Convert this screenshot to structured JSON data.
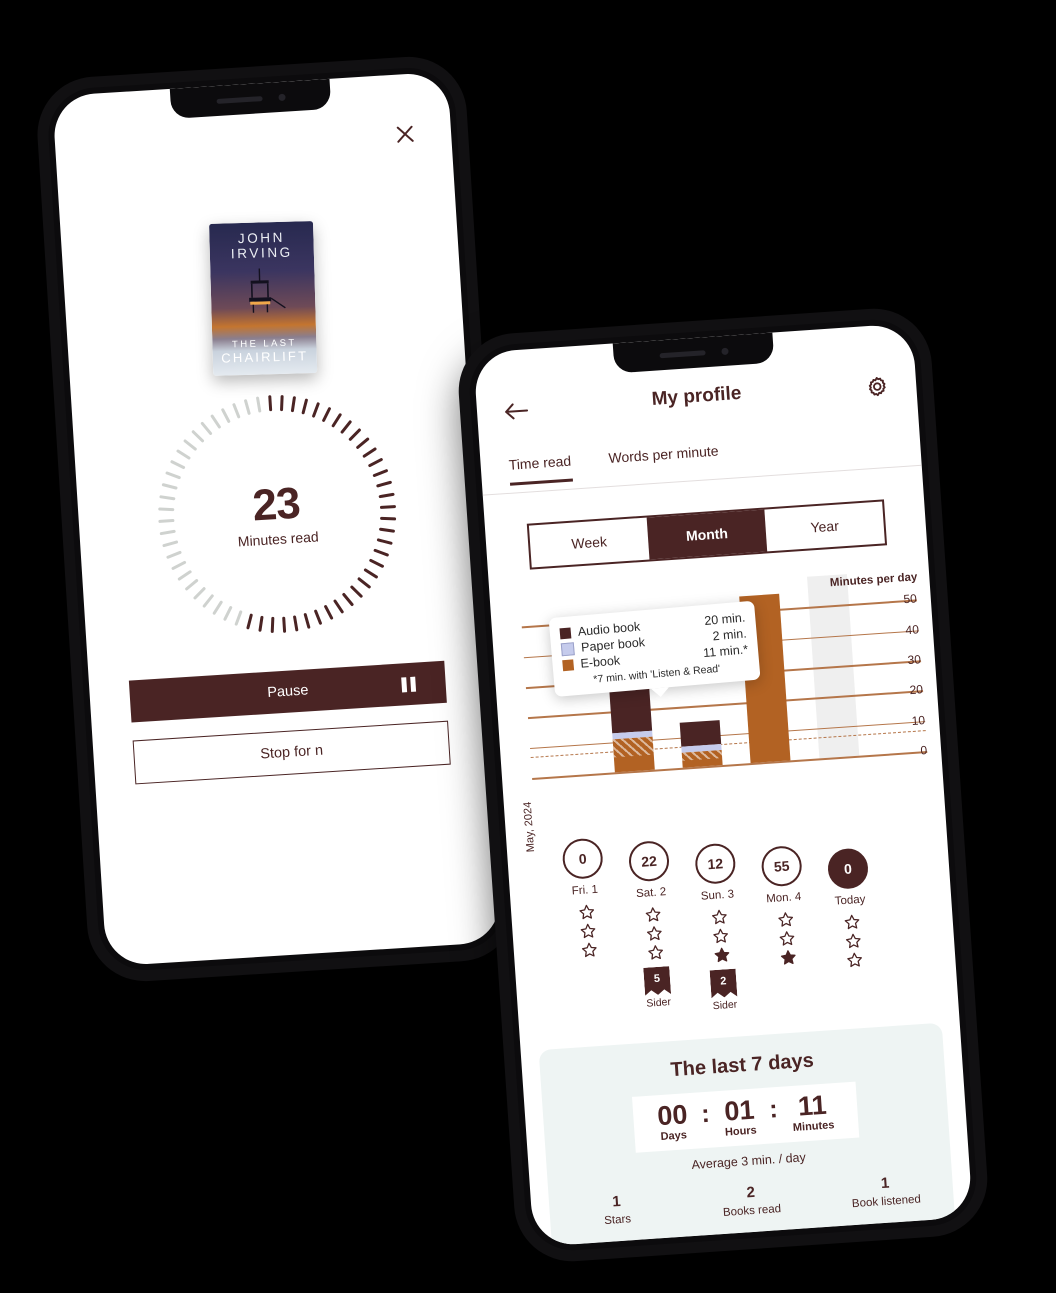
{
  "colors": {
    "brand": "#4A2424",
    "audio": "#4A2424",
    "paper": "#C5CBEC",
    "ebook": "#B26223",
    "grid": "#B5764A",
    "panel_bg": "#EEF4F3",
    "today_col": "#EFEFEF"
  },
  "reader": {
    "close_icon": "close-icon",
    "book": {
      "author": "JOHN IRVING",
      "author_line1": "JOHN",
      "author_line2": "IRVING",
      "title_line1": "THE LAST",
      "title_line2": "CHAIRLIFT"
    },
    "timer": {
      "value": "23",
      "label": "Minutes read",
      "ticks_total": 60,
      "ticks_active": 34
    },
    "pause_button": "Pause",
    "pause_icon": "pause-icon",
    "stop_button": "Stop for n"
  },
  "profile": {
    "back_icon": "back-arrow-icon",
    "title": "My profile",
    "settings_icon": "gear-icon",
    "tabs": [
      {
        "label": "Time read",
        "active": true
      },
      {
        "label": "Words per minute",
        "active": false
      }
    ],
    "range": [
      {
        "label": "Week",
        "active": false
      },
      {
        "label": "Month",
        "active": true
      },
      {
        "label": "Year",
        "active": false
      }
    ],
    "tooltip": {
      "rows": [
        {
          "name": "Audio book",
          "value": "20 min.",
          "color": "#4A2424"
        },
        {
          "name": "Paper book",
          "value": "2 min.",
          "color": "#C5CBEC"
        },
        {
          "name": "E-book",
          "value": "11 min.*",
          "color": "#B26223"
        }
      ],
      "note": "*7 min. with 'Listen & Read'"
    },
    "month_label": "May, 2024",
    "days": [
      {
        "value": "0",
        "label": "Fri. 1",
        "today": false,
        "stars_outline": 3,
        "stars_filled": 0,
        "badge": null
      },
      {
        "value": "22",
        "label": "Sat. 2",
        "today": false,
        "stars_outline": 3,
        "stars_filled": 0,
        "badge": {
          "num": "5",
          "label": "Sider"
        }
      },
      {
        "value": "12",
        "label": "Sun. 3",
        "today": false,
        "stars_outline": 2,
        "stars_filled": 1,
        "badge": {
          "num": "2",
          "label": "Sider"
        }
      },
      {
        "value": "55",
        "label": "Mon. 4",
        "today": false,
        "stars_outline": 2,
        "stars_filled": 1,
        "badge": null
      },
      {
        "value": "0",
        "label": "Today",
        "today": true,
        "stars_outline": 3,
        "stars_filled": 0,
        "badge": null
      }
    ],
    "last7": {
      "title": "The last 7 days",
      "days_value": "00",
      "days_label": "Days",
      "hours_value": "01",
      "hours_label": "Hours",
      "minutes_value": "11",
      "minutes_label": "Minutes",
      "separator": ":",
      "average": "Average 3 min. / day"
    },
    "stats": [
      {
        "value": "1",
        "label": "Stars"
      },
      {
        "value": "2",
        "label": "Books read"
      },
      {
        "value": "1",
        "label": "Book listened"
      }
    ]
  },
  "chart_data": {
    "type": "bar",
    "title": "Minutes per day",
    "ylabel": "Minutes per day",
    "xlabel": "",
    "ylim": [
      0,
      55
    ],
    "yticks": [
      0,
      10,
      20,
      30,
      40,
      50
    ],
    "categories": [
      "Fri. 1",
      "Sat. 2",
      "Sun. 3",
      "Mon. 4",
      "Today"
    ],
    "stacked": true,
    "average_line": 7,
    "series": [
      {
        "name": "E-book",
        "color": "#B26223",
        "values": [
          0,
          11,
          5,
          55,
          0
        ]
      },
      {
        "name": "Paper book",
        "color": "#C5CBEC",
        "values": [
          0,
          2,
          2,
          0,
          0
        ]
      },
      {
        "name": "Audio book",
        "color": "#4A2424",
        "values": [
          0,
          20,
          8,
          0,
          0
        ]
      }
    ],
    "totals": [
      0,
      33,
      15,
      55,
      0
    ],
    "day_totals_shown": [
      "0",
      "22",
      "12",
      "55",
      "0"
    ],
    "legend_position": "overlay-top-left",
    "grid": true
  }
}
